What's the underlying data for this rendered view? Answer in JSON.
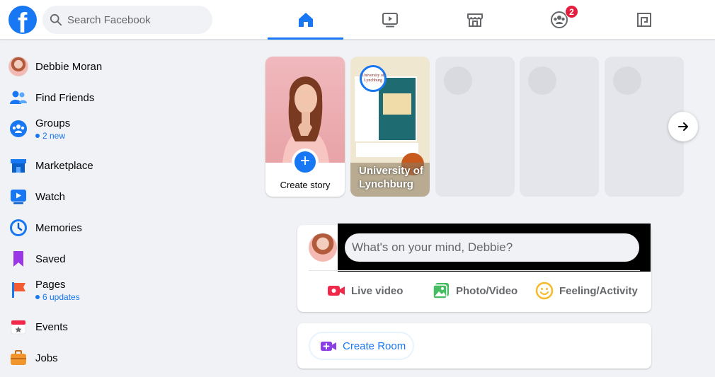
{
  "header": {
    "logo_letter": "f",
    "search_placeholder": "Search Facebook",
    "tabs": [
      {
        "name": "home",
        "active": true
      },
      {
        "name": "watch",
        "active": false
      },
      {
        "name": "marketplace",
        "active": false
      },
      {
        "name": "groups",
        "active": false,
        "badge": "2"
      },
      {
        "name": "gaming",
        "active": false
      }
    ],
    "accent_color": "#1877f2",
    "badge_color": "#e41e3f"
  },
  "sidebar": {
    "items": [
      {
        "label": "Debbie Moran",
        "icon": "profile-avatar"
      },
      {
        "label": "Find Friends",
        "icon": "friends-icon"
      },
      {
        "label": "Groups",
        "sub": "2 new",
        "icon": "groups-icon"
      },
      {
        "label": "Marketplace",
        "icon": "marketplace-icon"
      },
      {
        "label": "Watch",
        "icon": "watch-icon"
      },
      {
        "label": "Memories",
        "icon": "memories-icon"
      },
      {
        "label": "Saved",
        "icon": "bookmark-icon"
      },
      {
        "label": "Pages",
        "sub": "6 updates",
        "icon": "pages-flag-icon"
      },
      {
        "label": "Events",
        "icon": "calendar-icon"
      },
      {
        "label": "Jobs",
        "icon": "briefcase-icon"
      }
    ]
  },
  "stories": {
    "create_label": "Create story",
    "items": [
      {
        "label": "University of Lynchburg",
        "logo_text": "University of Lynchburg"
      }
    ],
    "placeholder_count": 3
  },
  "composer": {
    "placeholder": "What's on your mind, Debbie?",
    "actions": [
      {
        "label": "Live video",
        "icon": "live-video-icon",
        "color": "#f02849"
      },
      {
        "label": "Photo/Video",
        "icon": "photo-icon",
        "color": "#45bd62"
      },
      {
        "label": "Feeling/Activity",
        "icon": "smiley-icon",
        "color": "#f7b928"
      }
    ]
  },
  "room": {
    "label": "Create Room"
  }
}
